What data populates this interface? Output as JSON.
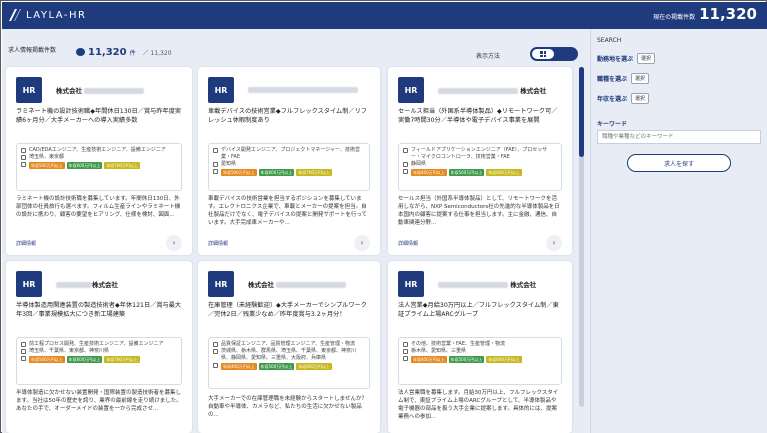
{
  "header": {
    "logo_text": "LAYLA-HR",
    "count_label": "現在の掲載件数",
    "count_value": "11,320",
    "count_unit": "件"
  },
  "list": {
    "label": "求人情報掲載件数",
    "count": "11,320",
    "count_unit": "件",
    "total": "／ 11,320",
    "display_label": "表示方法"
  },
  "cards": [
    {
      "company": "株式会社",
      "title": "ラミネート機の設計技術職◆年間休日130日／賞与昨年度実績6ヶ月分／大手メーカーへの導入実績多数",
      "category": "CAD/EDAエンジニア、生産技術エンジニア、設備エンジニア",
      "location": "埼玉県、東京都",
      "tags": [
        "年収500万円以上",
        "年収600万円以上",
        "年収700万円以上"
      ],
      "desc": "ラミネート機の設計技術職を募集しています。年間休日130日、外部団体の社員旅行も選べます。フィルム生産ラインやラミネート機の設計に携わり、顧客の要望をヒアリング、仕様を検討、図面...",
      "foot": "詳細情報"
    },
    {
      "company": "",
      "title": "車載デバイスの技術営業◆フルフレックスタイム制／リフレッシュ休暇制度あり",
      "category": "デバイス開発エンジニア、プロジェクトマネージャー、技術営業・FAE",
      "location": "愛知県",
      "tags": [
        "年収500万円以上",
        "年収600万円以上",
        "年収700万円以上"
      ],
      "desc": "車載デバイスの技術営業を担当するポジションを募集しています。エレクトロニクス企業で、車載とメーカーの提案を担当。自社製品だけでなく、電子デバイスの提案と開発サポートを行っています。大手完成車メーカーや...",
      "foot": "詳細情報"
    },
    {
      "company": "株式会社",
      "title": "セールス担当（外国系半導体製品）◆リモートワーク可／実働7時間30分／半導体や電子デバイス事業を展開",
      "category": "フィールドアプリケーションエンジニア（FAE）、プロセッサー・マイクロコントローラ、技術営業・FAE",
      "location": "静岡県",
      "tags": [
        "年収400万円以上",
        "年収500万円以上",
        "年収600万円以上"
      ],
      "desc": "セールス担当（外国系半導体製品）として、リモートワークを活用しながら、NXP Semiconductors社の先進的な半導体製品を日本国内の顧客に提案する仕事を担当します。主に金融、通信、自動車関連分野...",
      "foot": "詳細情報"
    },
    {
      "company": "株式会社",
      "title": "半導体製造用関連装置の製造技術者◆年休121日／賞与最大年3回／事業規模拡大につき新工場建築",
      "category": "前工程プロセス開発、生産技術エンジニア、設備エンジニア",
      "location": "埼玉県、千葉県、東京都、神奈川県",
      "tags": [
        "年収500万円以上",
        "年収600万円以上",
        "年収700万円以上"
      ],
      "desc": "半導体製造に欠かせない装置開発・国際装置の製造技術者を募集します。当社は50年の歴史を誇り、業界の最前線を走り続けました。あなたの手で、オーダーメイドの装置を一から完成させ...",
      "foot": ""
    },
    {
      "company": "株式会社",
      "title": "在庫管理（未経験歓迎）◆大手メーカーでシンプルワーク／完休2日／残業少なめ／昨年度賞与3.2ヶ月分！",
      "category": "品質保証エンジニア、品質管理エンジニア、生産管理・物流",
      "location": "茨城県、栃木県、群馬県、埼玉県、千葉県、東京都、神奈川県、静岡県、愛知県、三重県、大阪府、兵庫県",
      "tags": [
        "年収400万円以上",
        "年収500万円以上",
        "年収600万円以上"
      ],
      "desc": "大手メーカーでの在庫管理職を未経験からスタートしませんか？自動車や半導体、カメラなど、私たちの生活に欠かせない製品の...",
      "foot": ""
    },
    {
      "company": "株式会社",
      "title": "法人営業◆月給30万円以上／フルフレックスタイム制／東証プライム上場ARCグループ",
      "category": "その他、技術営業・FAE、生産管理・物流",
      "location": "栃木県、愛知県、三重県",
      "tags": [
        "年収400万円以上",
        "年収500万円以上",
        "年収600万円以上"
      ],
      "desc": "法人営業職を募集します。月給30万円以上、フルフレックスタイム制で、東証プライム上場のARCグループとして、半導体製品や電子機器の部品を扱う大手企業に提案します。具体的には、提案業務への参加...",
      "foot": ""
    }
  ],
  "sidebar": {
    "title": "SEARCH",
    "filters": [
      {
        "label": "勤務地を選ぶ",
        "button": "選択"
      },
      {
        "label": "職種を選ぶ",
        "button": "選択"
      },
      {
        "label": "年収を選ぶ",
        "button": "選択"
      }
    ],
    "keyword_label": "キーワード",
    "keyword_placeholder": "職種や業種などのキーワード",
    "search_button": "求人を探す"
  },
  "colors": {
    "brand": "#1f3b7d",
    "background": "#e8ecf5"
  }
}
